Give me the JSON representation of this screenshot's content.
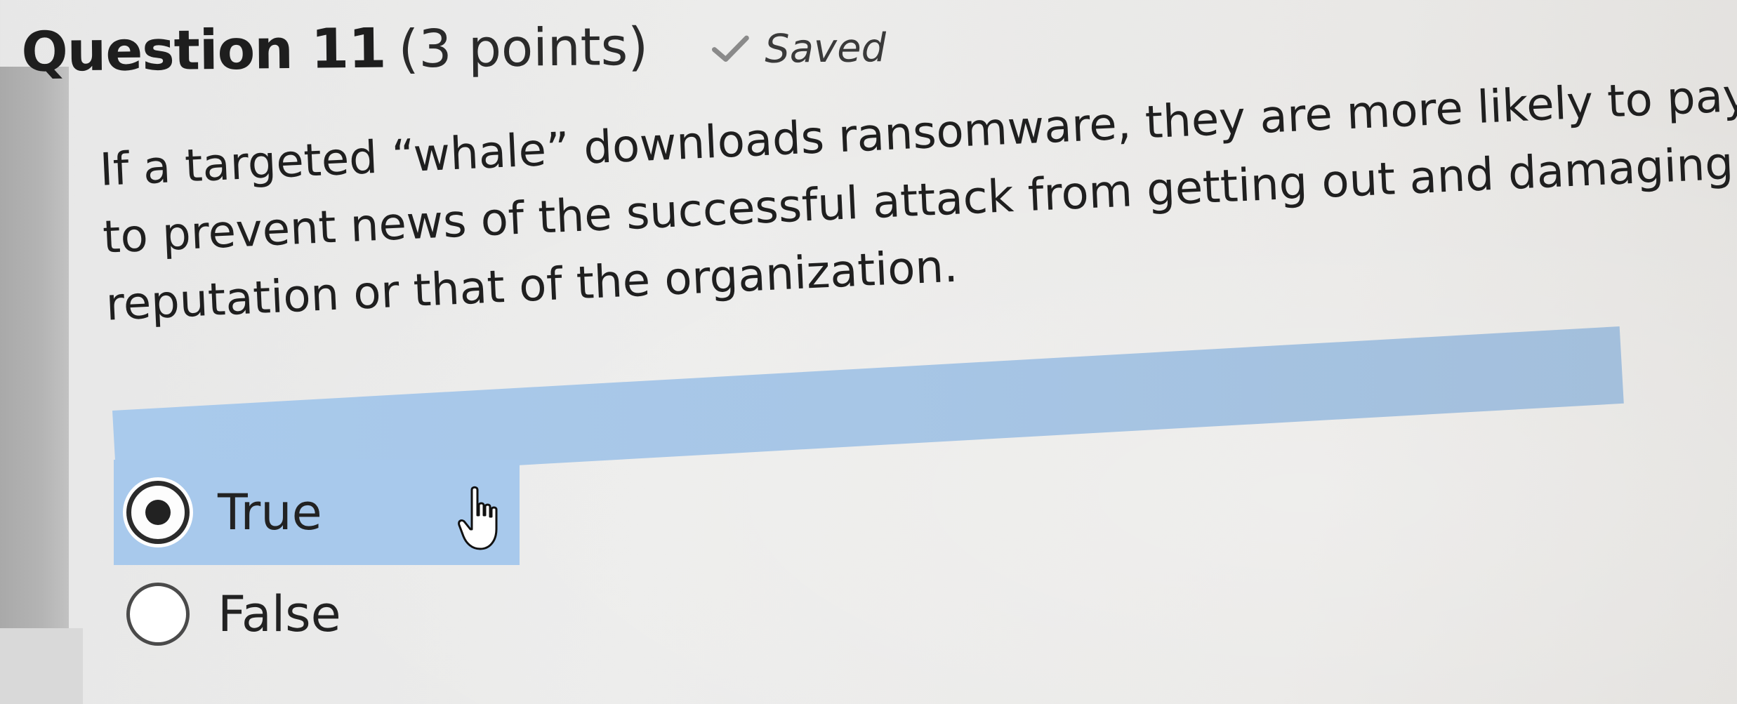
{
  "question": {
    "title": "Question 11",
    "points": "(3 points)",
    "saved_label": "Saved",
    "body_lines": [
      "If a targeted “whale” downloads ransomware, they are more likely to pay the ransom",
      "to prevent news of the successful attack from getting out and damaging their",
      "reputation or that of the organization."
    ]
  },
  "options": [
    {
      "label": "True",
      "selected": true
    },
    {
      "label": "False",
      "selected": false
    }
  ],
  "icons": {
    "saved": "check-icon",
    "cursor": "hand-pointer-icon"
  },
  "colors": {
    "highlight": "#a8c9ec",
    "check": "#8a8a8a",
    "text": "#1f1f1f"
  }
}
